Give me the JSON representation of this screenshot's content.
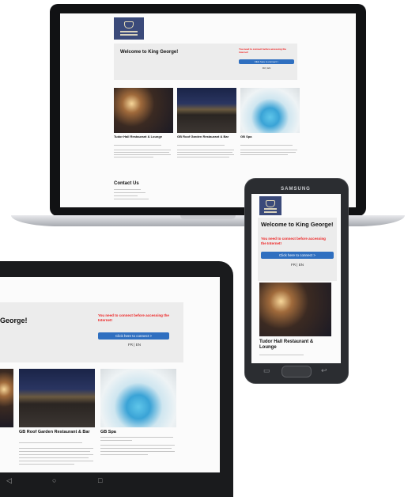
{
  "site": {
    "welcome": "Welcome to King George!",
    "welcome_tablet": "George!",
    "warning": "You need to connect before accessing the Internet!",
    "connect_button": "Click here to connect >",
    "pager": "FR | EN",
    "contact_heading": "Contact Us",
    "cards": [
      {
        "title": "Tudor Hall Restaurant & Lounge"
      },
      {
        "title": "GB Roof Garden Restaurant & Bar"
      },
      {
        "title": "GB Spa"
      }
    ]
  },
  "phone": {
    "brand": "SAMSUNG"
  },
  "tablet": {
    "nav_icons": [
      "back-icon",
      "home-icon",
      "recents-icon"
    ]
  },
  "colors": {
    "brand_blue": "#3b4a7a",
    "button_blue": "#2f6fc0",
    "warning_red": "#e22222"
  }
}
